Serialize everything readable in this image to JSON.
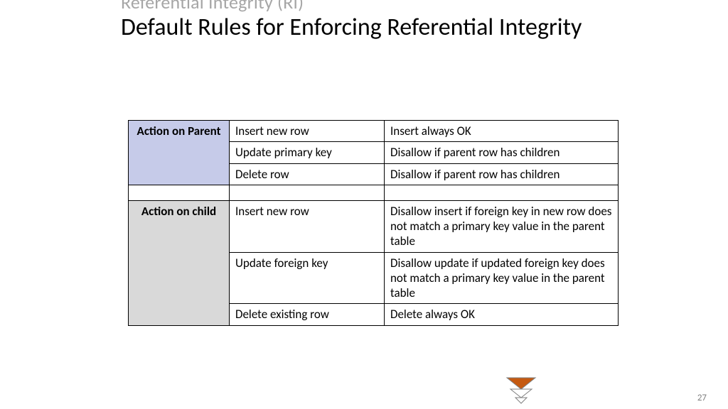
{
  "title": {
    "overline": "Referential Integrity (RI)",
    "main": "Default Rules for Enforcing Referential Integrity"
  },
  "table": {
    "sections": [
      {
        "header": "Action on Parent",
        "header_class": "rowhead-parent",
        "rows": [
          {
            "action": "Insert new row",
            "rule": "Insert always OK"
          },
          {
            "action": "Update primary key",
            "rule": "Disallow  if parent row has children"
          },
          {
            "action": "Delete row",
            "rule": "Disallow  if parent row has children"
          }
        ]
      },
      {
        "header": "Action on child",
        "header_class": "rowhead-child",
        "rows": [
          {
            "action": "Insert new row",
            "rule": "Disallow insert if  foreign key in new row does not match a primary key value in the parent table"
          },
          {
            "action": "Update foreign key",
            "rule": "Disallow update if updated foreign key does not match a primary key value in the parent table"
          },
          {
            "action": "Delete existing row",
            "rule": "Delete always OK"
          }
        ]
      }
    ]
  },
  "page_number": "27"
}
